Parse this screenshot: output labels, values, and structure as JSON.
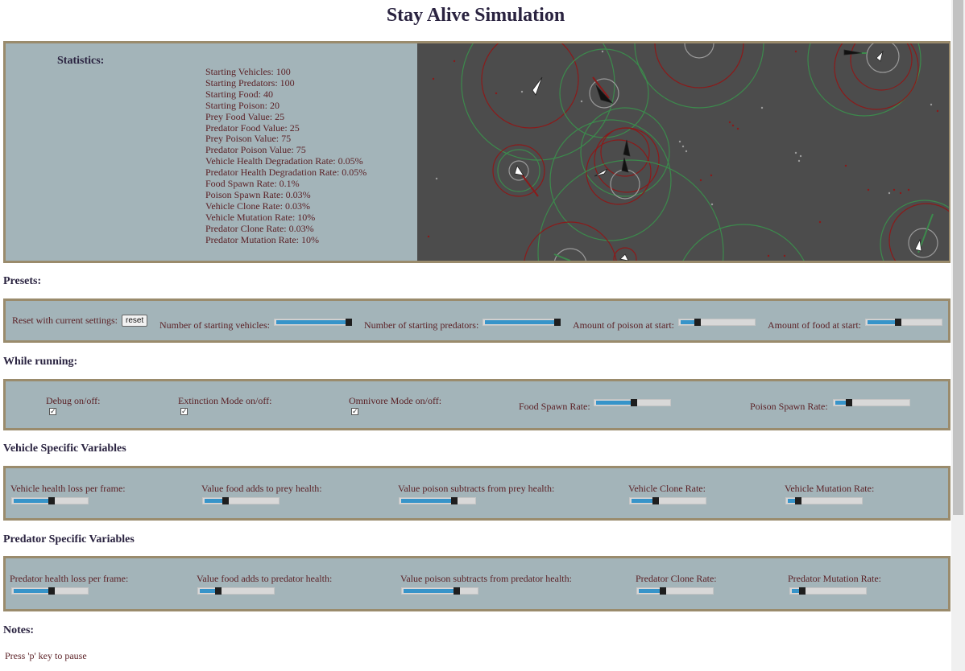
{
  "title": "Stay Alive Simulation",
  "stats": {
    "heading": "Statistics:",
    "lines": [
      "Starting Vehicles: 100",
      "Starting Predators: 100",
      "Starting Food: 40",
      "Starting Poison: 20",
      "Prey Food Value: 25",
      "Predator Food Value: 25",
      "Prey Poison Value: 75",
      "Predator Poison Value: 75",
      "Vehicle Health Degradation Rate: 0.05%",
      "Predator Health Degradation Rate: 0.05%",
      "Food Spawn Rate: 0.1%",
      "Poison Spawn Rate: 0.03%",
      "Vehicle Clone Rate: 0.03%",
      "Vehicle Mutation Rate: 10%",
      "Predator Clone Rate: 0.03%",
      "Predator Mutation Rate: 10%"
    ]
  },
  "presets": {
    "heading": "Presets:",
    "reset_label": "Reset with current settings:",
    "reset_button": "reset",
    "sliders": [
      {
        "label": "Number of starting vehicles:",
        "value": 1.0
      },
      {
        "label": "Number of starting predators:",
        "value": 1.0
      },
      {
        "label": "Amount of poison at start:",
        "value": 0.2
      },
      {
        "label": "Amount of food at start:",
        "value": 0.4
      }
    ]
  },
  "running": {
    "heading": "While running:",
    "checkboxes": [
      {
        "label": "Debug on/off:",
        "checked": true
      },
      {
        "label": "Extinction Mode on/off:",
        "checked": true
      },
      {
        "label": "Omnivore Mode on/off:",
        "checked": true
      }
    ],
    "sliders": [
      {
        "label": "Food Spawn Rate:",
        "value": 0.5
      },
      {
        "label": "Poison Spawn Rate:",
        "value": 0.15
      }
    ]
  },
  "vehicle": {
    "heading": "Vehicle Specific Variables",
    "sliders": [
      {
        "label": "Vehicle health loss per frame:",
        "value": 0.5
      },
      {
        "label": "Value food adds to prey health:",
        "value": 0.25
      },
      {
        "label": "Value poison subtracts from prey health:",
        "value": 0.72
      },
      {
        "label": "Vehicle Clone Rate:",
        "value": 0.3
      },
      {
        "label": "Vehicle Mutation Rate:",
        "value": 0.1
      }
    ]
  },
  "predator": {
    "heading": "Predator Specific Variables",
    "sliders": [
      {
        "label": "Predator health loss per frame:",
        "value": 0.5
      },
      {
        "label": "Value food adds to predator health:",
        "value": 0.22
      },
      {
        "label": "Value poison subtracts from predator health:",
        "value": 0.72
      },
      {
        "label": "Predator Clone Rate:",
        "value": 0.3
      },
      {
        "label": "Predator Mutation Rate:",
        "value": 0.1
      }
    ]
  },
  "notes": {
    "heading": "Notes:",
    "text": "Press 'p' key to pause"
  },
  "colors": {
    "panel_bg": "#a3b4b9",
    "panel_border": "#9a8b6c",
    "canvas_bg": "#4c4c4c",
    "food": "#3c8a4c",
    "poison": "#8b1a1a",
    "slider_fill": "#3794c9"
  }
}
